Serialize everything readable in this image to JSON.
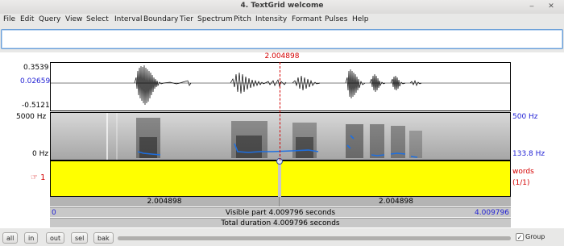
{
  "window": {
    "title": "4. TextGrid welcome",
    "buttons": {
      "minimize": "‒",
      "close": "✕"
    }
  },
  "menu": [
    "File",
    "Edit",
    "Query",
    "View",
    "Select",
    "Interval",
    "Boundary",
    "Tier",
    "Spectrum",
    "Pitch",
    "Intensity",
    "Formant",
    "Pulses",
    "Help"
  ],
  "textfield": {
    "value": ""
  },
  "cursor": {
    "time_label": "2.004898",
    "time": 2.004898
  },
  "waveform": {
    "ymax": "0.3539",
    "ycursor": "0.02659",
    "ymin": "-0.5121"
  },
  "spectrogram": {
    "left_top": "5000 Hz",
    "left_bottom": "0 Hz",
    "right_top": "500 Hz",
    "right_bottom": "133.8 Hz"
  },
  "tier": {
    "number": "1",
    "pointer_icon": "hand-pointer-icon",
    "name": "words",
    "count": "(1/1)"
  },
  "bars": {
    "left_duration": "2.004898",
    "right_duration": "2.004898",
    "visible_start": "0",
    "visible_label": "Visible part 4.009796 seconds",
    "visible_end": "4.009796",
    "total_label": "Total duration 4.009796 seconds"
  },
  "toolbar": {
    "buttons": [
      "all",
      "in",
      "out",
      "sel",
      "bak"
    ],
    "group_label": "Group",
    "group_checked": true
  }
}
